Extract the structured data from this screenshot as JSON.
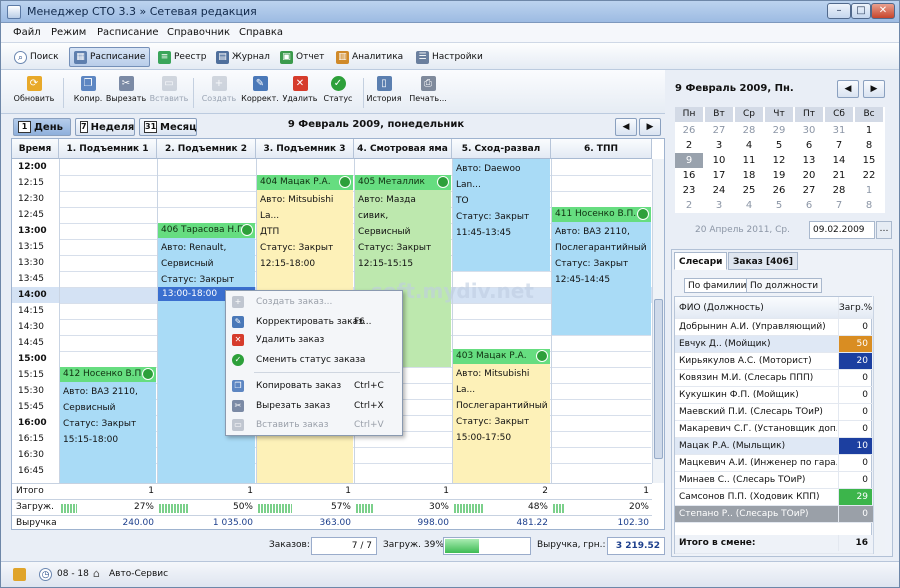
{
  "window": {
    "title": "Менеджер СТО 3.3 » Сетевая редакция",
    "min": "–",
    "max": "□",
    "close": "✕"
  },
  "menu": [
    "Файл",
    "Режим",
    "Расписание",
    "Справочник",
    "Справка"
  ],
  "nav": [
    "Поиск",
    "Расписание",
    "Реестр",
    "Журнал",
    "Отчет",
    "Аналитика",
    "Настройки"
  ],
  "toolbar": [
    {
      "label": "Обновить",
      "enabled": true
    },
    {
      "label": "Копир.",
      "enabled": true
    },
    {
      "label": "Вырезать",
      "enabled": true
    },
    {
      "label": "Вставить",
      "enabled": false
    },
    {
      "label": "Создать",
      "enabled": false
    },
    {
      "label": "Коррект.",
      "enabled": true
    },
    {
      "label": "Удалить",
      "enabled": true
    },
    {
      "label": "Статус",
      "enabled": true
    },
    {
      "label": "История",
      "enabled": true
    },
    {
      "label": "Печать...",
      "enabled": true
    }
  ],
  "views": [
    {
      "num": "1",
      "label": "День"
    },
    {
      "num": "7",
      "label": "Неделя"
    },
    {
      "num": "31",
      "label": "Месяц"
    }
  ],
  "schedule": {
    "date_title": "9 Февраль 2009, понедельник",
    "time_header": "Время",
    "columns": [
      "1. Подъемник 1",
      "2. Подъемник 2",
      "3. Подъемник 3",
      "4. Смотровая яма",
      "5. Сход-развал",
      "6. ТПП"
    ],
    "times": [
      "12:00",
      "12:15",
      "12:30",
      "12:45",
      "13:00",
      "13:15",
      "13:30",
      "13:45",
      "14:00",
      "14:15",
      "14:30",
      "14:45",
      "15:00",
      "15:15",
      "15:30",
      "15:45",
      "16:00",
      "16:15",
      "16:30",
      "16:45"
    ],
    "selection_label": "13:00-18:00",
    "appointments": {
      "a412": {
        "header": "412 Носенко В.П.",
        "l1": "Авто: ВАЗ 2110,",
        "l2": "Сервисный",
        "l3": "Статус: Закрыт",
        "l4": "15:15-18:00"
      },
      "a406": {
        "header": "406 Тарасова Н.П.",
        "l1": "Авто: Renault,",
        "l2": "Сервисный",
        "l3": "Статус: Закрыт"
      },
      "a404": {
        "header": "404 Мацак Р.А.",
        "l1": "Авто: Mitsubishi La...",
        "l2": "ДТП",
        "l3": "Статус: Закрыт",
        "l4": "12:15-18:00"
      },
      "a405": {
        "header": "405 Металлик",
        "l1": "Авто: Мазда сивик,",
        "l2": "Сервисный",
        "l3": "Статус: Закрыт",
        "l4": "12:15-15:15"
      },
      "a_cam": {
        "l0": "Авто: Daewoo Lan...",
        "l1": "ТО",
        "l2": "Статус: Закрыт",
        "l3": "11:45-13:45"
      },
      "a403": {
        "header": "403 Мацак Р.А.",
        "l1": "Авто: Mitsubishi La...",
        "l2": "Послегарантийный",
        "l3": "Статус: Закрыт",
        "l4": "15:00-17:50"
      },
      "a411": {
        "header": "411 Носенко В.П.",
        "l1": "Авто: ВАЗ 2110,",
        "l2": "Послегарантийный",
        "l3": "Статус: Закрыт",
        "l4": "12:45-14:45"
      }
    },
    "summary": {
      "total_label": "Итого",
      "load_label": "Загруж.",
      "revenue_label": "Выручка",
      "totals": [
        "1",
        "1",
        "1",
        "1",
        "2",
        "1"
      ],
      "loads": [
        "27%",
        "50%",
        "57%",
        "30%",
        "48%",
        "20%"
      ],
      "load_fraction": [
        0.27,
        0.5,
        0.57,
        0.3,
        0.48,
        0.2
      ],
      "revenues": [
        "240.00",
        "1 035.00",
        "363.00",
        "998.00",
        "481.22",
        "102.30"
      ]
    }
  },
  "context_menu": {
    "create": "Создать заказ...",
    "edit": "Корректировать заказ...",
    "edit_key": "F6",
    "delete": "Удалить заказ",
    "status": "Сменить статус заказа",
    "copy": "Копировать заказ",
    "copy_key": "Ctrl+C",
    "cut": "Вырезать заказ",
    "cut_key": "Ctrl+X",
    "paste": "Вставить заказ",
    "paste_key": "Ctrl+V"
  },
  "watermark": "soft.mydiv.net",
  "bottom": {
    "orders_label": "Заказов:",
    "orders_value": "7 / 7",
    "load_label": "Загруж. 39%",
    "load_fraction": 0.39,
    "revenue_label": "Выручка, грн.:",
    "revenue_value": "3 219.52"
  },
  "calendar": {
    "title": "9 Февраль 2009, Пн.",
    "weekdays": [
      "Пн",
      "Вт",
      "Ср",
      "Чт",
      "Пт",
      "Сб",
      "Вс"
    ],
    "weeks": [
      [
        "26",
        "27",
        "28",
        "29",
        "30",
        "31",
        "1"
      ],
      [
        "2",
        "3",
        "4",
        "5",
        "6",
        "7",
        "8"
      ],
      [
        "9",
        "10",
        "11",
        "12",
        "13",
        "14",
        "15"
      ],
      [
        "16",
        "17",
        "18",
        "19",
        "20",
        "21",
        "22"
      ],
      [
        "23",
        "24",
        "25",
        "26",
        "27",
        "28",
        "1"
      ],
      [
        "2",
        "3",
        "4",
        "5",
        "6",
        "7",
        "8"
      ]
    ],
    "today_label": "20 Апрель 2011, Ср.",
    "date_value": "09.02.2009"
  },
  "staff": {
    "tabs": [
      "Слесари",
      "Заказ [406]"
    ],
    "subtabs": [
      "По фамилии",
      "По должности"
    ],
    "col_name": "ФИО (Должность)",
    "col_load": "Загр.%",
    "rows": [
      {
        "name": "Добрынин А.И. (Управляющий)",
        "load": "0"
      },
      {
        "name": "Евчук Д.. (Мойщик)",
        "load": "50"
      },
      {
        "name": "Кирьякулов А.С. (Моторист)",
        "load": "20"
      },
      {
        "name": "Ковязин М.И. (Слесарь ППП)",
        "load": "0"
      },
      {
        "name": "Кукушкин Ф.П. (Мойщик)",
        "load": "0"
      },
      {
        "name": "Маевский П.И. (Слесарь ТОиР)",
        "load": "0"
      },
      {
        "name": "Макаревич С.Г. (Установщик доп.)",
        "load": "0"
      },
      {
        "name": "Мацак Р.А. (Мыльщик)",
        "load": "10"
      },
      {
        "name": "Мацкевич А.И. (Инженер по гара...",
        "load": "0"
      },
      {
        "name": "Минаев С.. (Слесарь ТОиР)",
        "load": "0"
      },
      {
        "name": "Самсонов П.П. (Ходовик КПП)",
        "load": "29"
      },
      {
        "name": "Степано Р.. (Слесарь ТОиР)",
        "load": "0"
      }
    ],
    "total_label": "Итого в смене:",
    "total_value": "16"
  },
  "statusbar": {
    "hours": "08 - 18",
    "company": "Авто-Сервис"
  },
  "colors": {
    "accent": "#7bd08a",
    "appointment_header": "#66dd80",
    "blue": "#a9dbf6",
    "yellow": "#fdf1b8",
    "green": "#bde8ae"
  }
}
